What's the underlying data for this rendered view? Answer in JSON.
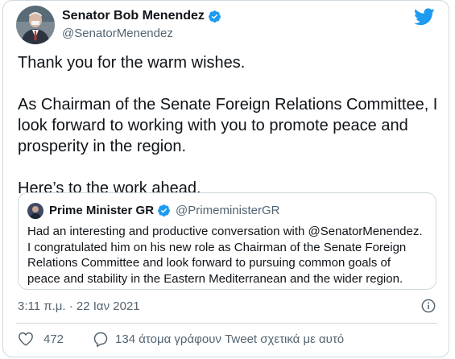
{
  "author": {
    "name": "Senator Bob Menendez",
    "handle": "@SenatorMenendez",
    "verified": true
  },
  "tweet": {
    "paragraphs": [
      [
        "Thank you for the warm wishes."
      ],
      [
        "As Chairman of the Senate Foreign Relations Committee, I",
        "look forward to working with you to promote peace and",
        "prosperity in the region."
      ],
      [
        "Here’s to the work ahead."
      ]
    ]
  },
  "quoted": {
    "name": "Prime Minister GR",
    "handle": "@PrimeministerGR",
    "lines": [
      "Had an interesting and productive conversation with @SenatorMenendez.",
      "I congratulated him on his new role as Chairman of the Senate Foreign",
      "Relations Committee and look forward to pursuing common goals of",
      "peace and stability in the Eastern Mediterranean and the wider region."
    ]
  },
  "timestamp": "3:11 π.μ. · 22 Ιαν 2021",
  "actions": {
    "like_count": "472",
    "replies_text": "134 άτομα γράφουν Tweet σχετικά με αυτό"
  },
  "colors": {
    "twitter_blue": "#1d9bf0",
    "secondary_text": "#536471",
    "border": "#cfd9de"
  },
  "icons": [
    "avatar",
    "verified-badge-icon",
    "twitter-bird-icon",
    "info-icon",
    "heart-icon",
    "speech-bubble-icon"
  ]
}
